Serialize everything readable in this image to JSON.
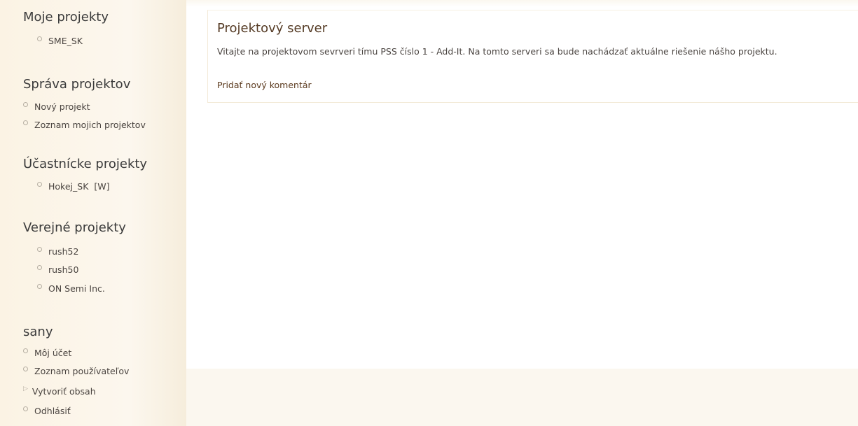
{
  "sidebar": {
    "my_projects": {
      "title": "Moje projekty",
      "items": [
        {
          "label": "SME_SK"
        }
      ]
    },
    "project_admin": {
      "title": "Správa projektov",
      "items": [
        {
          "label": "Nový projekt"
        },
        {
          "label": "Zoznam mojich projektov"
        }
      ]
    },
    "participant_projects": {
      "title": "Účastnícke projekty",
      "items": [
        {
          "label": "Hokej_SK  [W]"
        }
      ]
    },
    "public_projects": {
      "title": "Verejné projekty",
      "items": [
        {
          "label": "rush52"
        },
        {
          "label": "rush50"
        },
        {
          "label": "ON Semi Inc."
        }
      ]
    },
    "user": {
      "title": "sany",
      "items": [
        {
          "label": "Môj účet",
          "icon": "circle-bullet-icon"
        },
        {
          "label": "Zoznam používateľov",
          "icon": "circle-bullet-icon"
        },
        {
          "label": "Vytvoriť obsah",
          "icon": "triangle-right-icon"
        },
        {
          "label": "Odhlásiť",
          "icon": "circle-bullet-icon"
        }
      ]
    }
  },
  "main": {
    "title": "Projektový server",
    "intro": "Vitajte na projektovom sevrveri tímu PSS číslo 1 - Add-It. Na tomto serveri sa bude nachádzať aktuálne riešenie nášho projektu.",
    "comment_link": "Pridať nový komentár"
  },
  "colors": {
    "sidebar_bg": "#fbf3e4",
    "page_bg": "#fbf7ef",
    "content_bg": "#ffffff",
    "title_color": "#553b25",
    "link_color": "#4a4440"
  }
}
